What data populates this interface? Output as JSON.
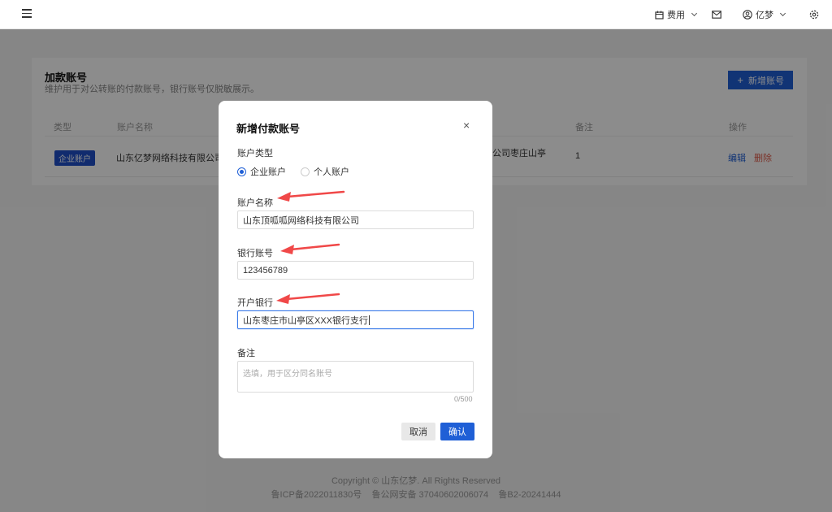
{
  "topbar": {
    "fee_label": "费用",
    "user_label": "亿梦"
  },
  "page": {
    "title": "加款账号",
    "subtitle": "维护用于对公转账的付款账号，银行账号仅脱敏展示。",
    "add_button": "新增账号",
    "table": {
      "headers": {
        "type": "类型",
        "name": "账户名称",
        "remark": "备注",
        "ops": "操作"
      },
      "row": {
        "type_tag": "企业账户",
        "name": "山东亿梦网络科技有限公司",
        "bank_partial": "限公司枣庄山亭",
        "remark": "1",
        "edit": "编辑",
        "delete": "删除"
      }
    }
  },
  "footer": {
    "copyright": "Copyright © 山东亿梦. All Rights Reserved",
    "records": "鲁ICP备2022011830号    鲁公网安备 37040602006074    鲁B2-20241444"
  },
  "modal": {
    "title": "新增付款账号",
    "close": "×",
    "account_type_label": "账户类型",
    "account_type_options": [
      "企业账户",
      "个人账户"
    ],
    "account_type_selected": "企业账户",
    "account_name_label": "账户名称",
    "account_name_value": "山东顶呱呱网络科技有限公司",
    "bank_account_label": "银行账号",
    "bank_account_value": "123456789",
    "bank_label": "开户银行",
    "bank_value": "山东枣庄市山亭区XXX银行支行",
    "remark_label": "备注",
    "remark_placeholder": "选填，用于区分同名账号",
    "remark_counter": "0/500",
    "cancel": "取消",
    "confirm": "确认"
  },
  "colors": {
    "primary": "#1f5fd6",
    "danger": "#e05a4a",
    "annotation_arrow": "#f04848"
  }
}
